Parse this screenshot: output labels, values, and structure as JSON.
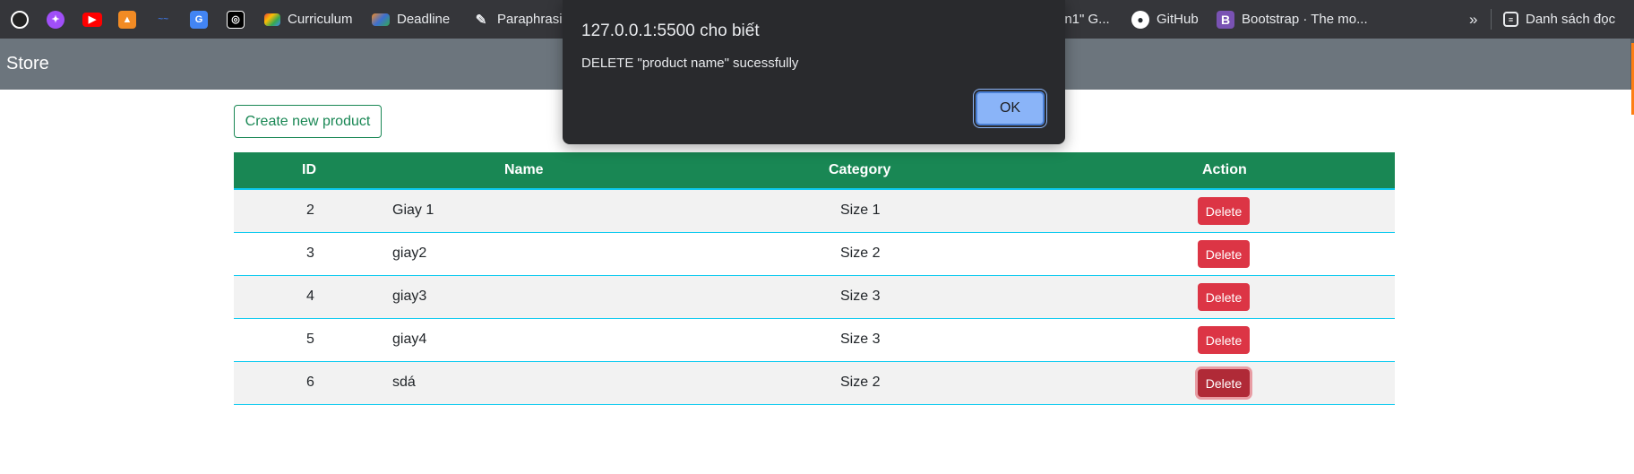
{
  "bookmarks": {
    "items": [
      {
        "label": "",
        "icon": "compass-icon",
        "color": "#ffffff"
      },
      {
        "label": "",
        "icon": "messenger-icon",
        "color": "#a04ff8"
      },
      {
        "label": "",
        "icon": "youtube-icon",
        "color": "#ff0000"
      },
      {
        "label": "",
        "icon": "shapes-icon",
        "color": "#f28b24"
      },
      {
        "label": "",
        "icon": "script-logo-icon",
        "color": "#3d6fd1"
      },
      {
        "label": "",
        "icon": "translate-icon",
        "color": "#4285f4"
      },
      {
        "label": "",
        "icon": "openai-icon",
        "color": "#ffffff"
      },
      {
        "label": "Curriculum",
        "icon": "curriculum-icon"
      },
      {
        "label": "Deadline",
        "icon": "deadline-icon"
      },
      {
        "label": "Paraphrasin",
        "icon": "feather-icon"
      },
      {
        "label": "in1\" G...",
        "icon": ""
      },
      {
        "label": "GitHub",
        "icon": "github-icon"
      },
      {
        "label": "Bootstrap · The mo...",
        "icon": "bootstrap-icon",
        "color": "#7952b3"
      }
    ],
    "overflow": "»",
    "reading_list": "Danh sách đọc"
  },
  "navbar": {
    "brand": "Store"
  },
  "create_button": "Create new product",
  "table": {
    "headers": [
      "ID",
      "Name",
      "Category",
      "Action"
    ],
    "rows": [
      {
        "id": "2",
        "name": "Giay 1",
        "category": "Size 1",
        "action": "Delete"
      },
      {
        "id": "3",
        "name": "giay2",
        "category": "Size 2",
        "action": "Delete"
      },
      {
        "id": "4",
        "name": "giay3",
        "category": "Size 3",
        "action": "Delete"
      },
      {
        "id": "5",
        "name": "giay4",
        "category": "Size 3",
        "action": "Delete"
      },
      {
        "id": "6",
        "name": "sdá",
        "category": "Size 2",
        "action": "Delete"
      }
    ]
  },
  "dialog": {
    "title": "127.0.0.1:5500 cho biết",
    "message": "DELETE \"product name\" sucessfully",
    "ok_label": "OK"
  }
}
